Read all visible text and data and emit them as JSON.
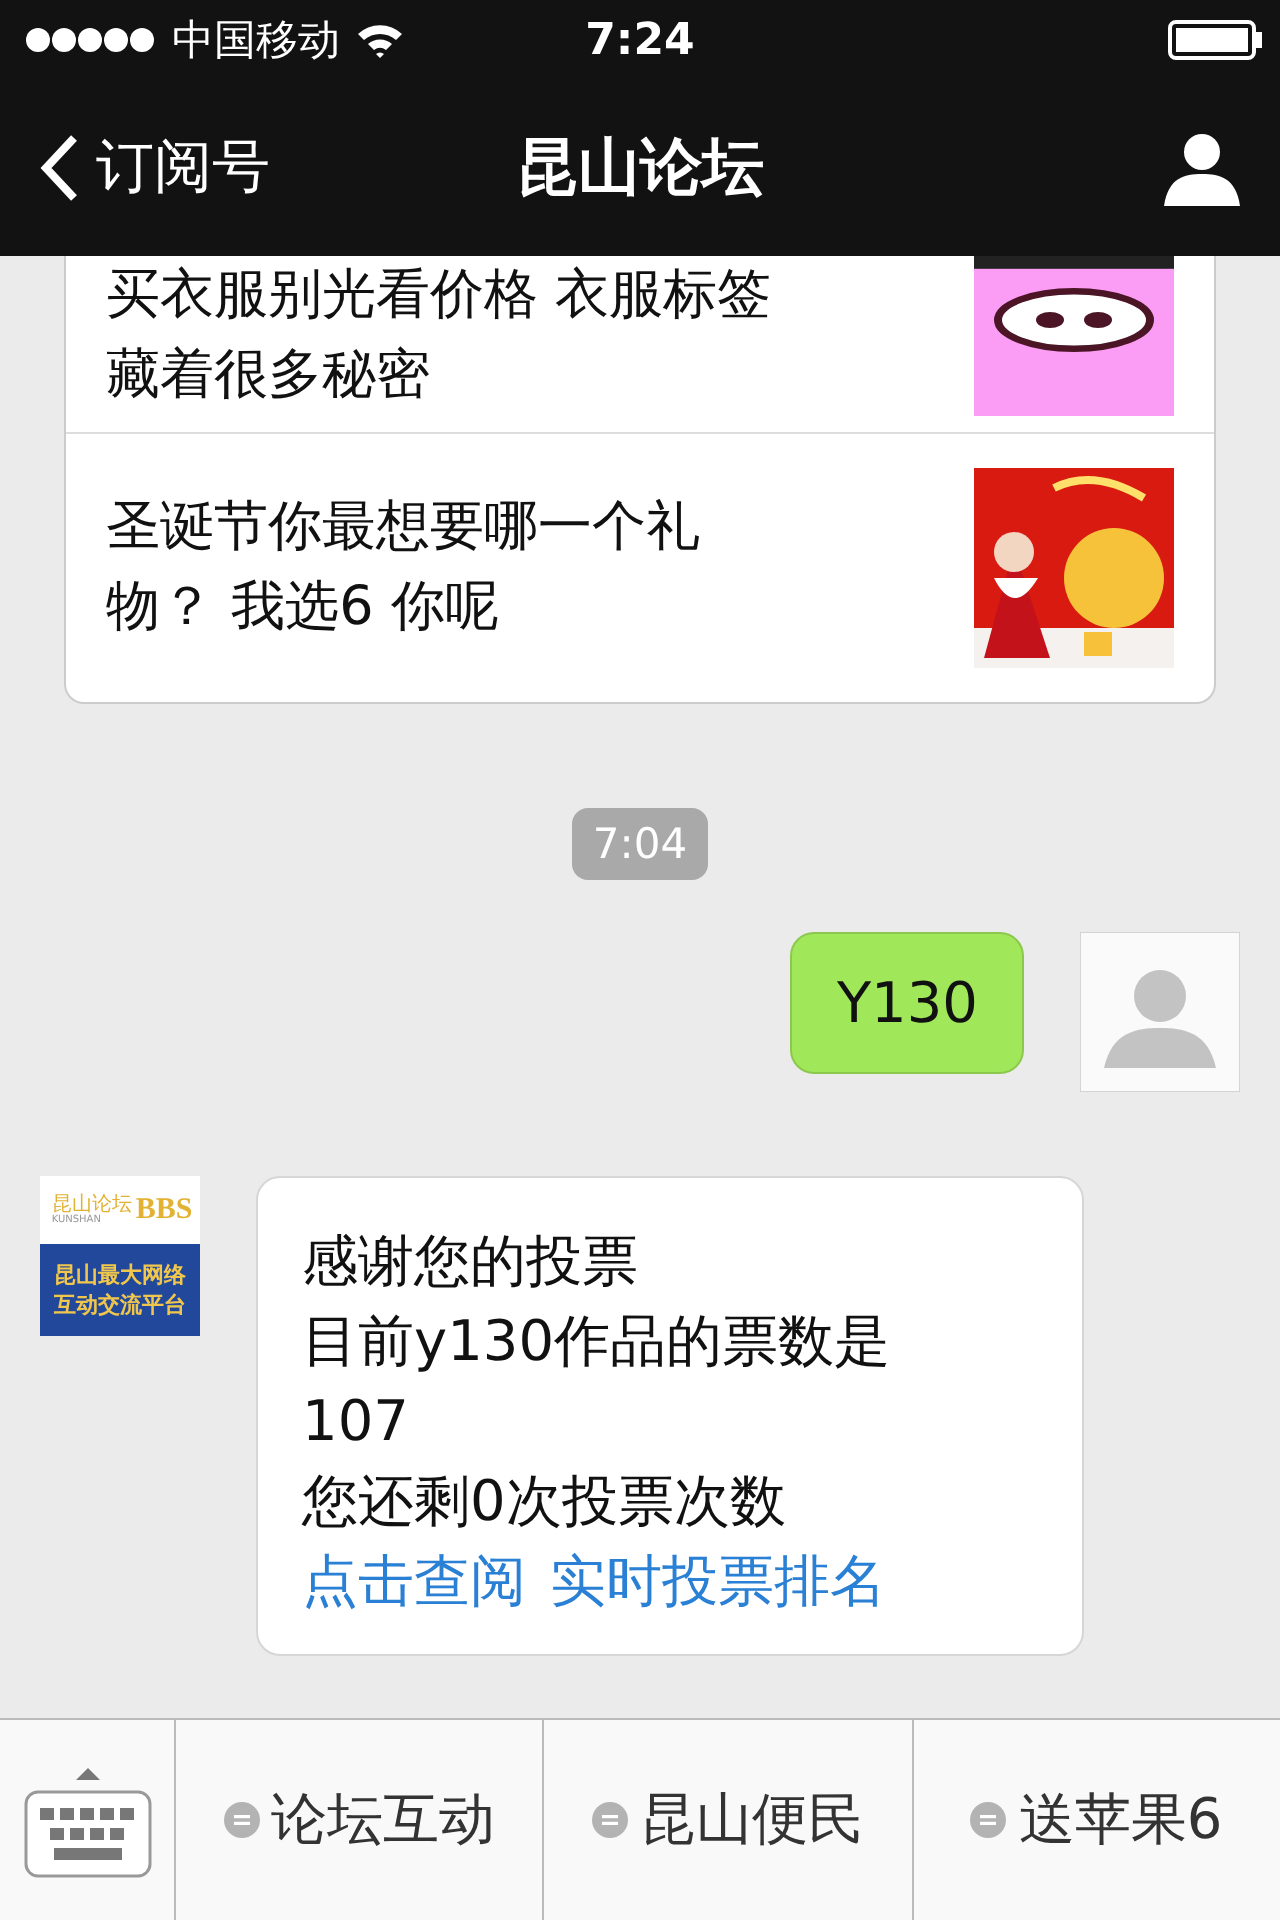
{
  "status_bar": {
    "carrier": "中国移动",
    "time": "7:24"
  },
  "nav": {
    "back": "订阅号",
    "title": "昆山论坛"
  },
  "articles": [
    {
      "title": [
        "买衣服别光看价格 衣服标签",
        "藏着很多秘密"
      ],
      "thumbnail": {
        "kind": "picture"
      }
    },
    {
      "title": [
        "圣诞节你最想要哪一个礼",
        "物？ 我选6 你呢"
      ],
      "thumbnail": {
        "kind": "picture"
      }
    }
  ],
  "timestamp": "7:04",
  "messages": [
    {
      "kind": "sent",
      "lines": [
        "Y130"
      ]
    },
    {
      "kind": "received",
      "avatar": {
        "logo_cn": "昆山论坛",
        "logo_en": "KUNSHAN",
        "logo_bbs": "BBS",
        "slogan": [
          "昆山最大网络",
          "互动交流平台"
        ]
      },
      "lines": [
        "感谢您的投票",
        "目前y130作品的票数是",
        "107",
        "您还剩0次投票次数"
      ],
      "links": [
        "点击查阅",
        "实时投票排名"
      ]
    }
  ],
  "menu": [
    "论坛互动",
    "昆山便民",
    "送苹果6"
  ]
}
